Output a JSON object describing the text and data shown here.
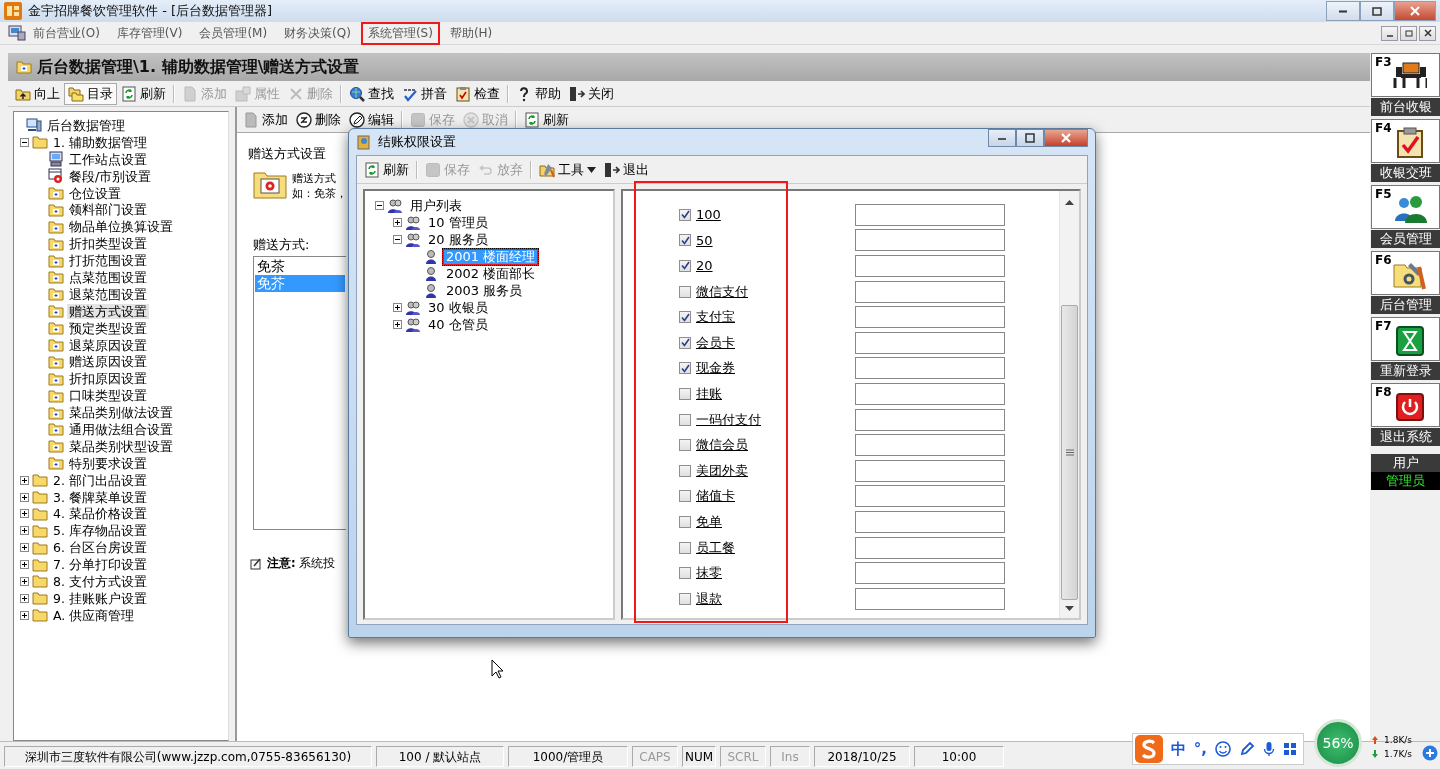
{
  "window": {
    "title": "金宇招牌餐饮管理软件 - [后台数据管理器]"
  },
  "menu": [
    {
      "label": "前台营业(O)",
      "annotated": false
    },
    {
      "label": "库存管理(V)",
      "annotated": false
    },
    {
      "label": "会员管理(M)",
      "annotated": false
    },
    {
      "label": "财务决策(Q)",
      "annotated": false
    },
    {
      "label": "系统管理(S)",
      "annotated": true
    },
    {
      "label": "帮助(H)",
      "annotated": false
    }
  ],
  "path": "后台数据管理\\1. 辅助数据管理\\赠送方式设置",
  "toolbar": [
    [
      {
        "kind": "up",
        "label": "向上",
        "disabled": false,
        "selected": false
      },
      {
        "kind": "catalog",
        "label": "目录",
        "disabled": false,
        "selected": true
      },
      {
        "kind": "refresh",
        "label": "刷新",
        "disabled": false,
        "selected": false
      }
    ],
    [
      {
        "kind": "add",
        "label": "添加",
        "disabled": true,
        "selected": false
      },
      {
        "kind": "props",
        "label": "属性",
        "disabled": true,
        "selected": false
      },
      {
        "kind": "delete",
        "label": "删除",
        "disabled": true,
        "selected": false
      }
    ],
    [
      {
        "kind": "find",
        "label": "查找",
        "disabled": false,
        "selected": false
      },
      {
        "kind": "spell",
        "label": "拼音",
        "disabled": false,
        "selected": false
      },
      {
        "kind": "check",
        "label": "检查",
        "disabled": false,
        "selected": false
      }
    ],
    [
      {
        "kind": "help",
        "label": "帮助",
        "disabled": false,
        "selected": false
      },
      {
        "kind": "exit",
        "label": "关闭",
        "disabled": false,
        "selected": false
      }
    ]
  ],
  "nav_tree": {
    "label": "后台数据管理",
    "kind": "root",
    "selected": false,
    "children": [
      {
        "label": "1. 辅助数据管理",
        "kind": "group",
        "selected": false,
        "expanded": true,
        "children": [
          {
            "label": "工作站点设置",
            "kind": "station",
            "selected": false
          },
          {
            "label": "餐段/市别设置",
            "kind": "schedule",
            "selected": false
          },
          {
            "label": "仓位设置",
            "kind": "entry",
            "selected": false
          },
          {
            "label": "领料部门设置",
            "kind": "entry",
            "selected": false
          },
          {
            "label": "物品单位换算设置",
            "kind": "entry",
            "selected": false
          },
          {
            "label": "折扣类型设置",
            "kind": "entry",
            "selected": false
          },
          {
            "label": "打折范围设置",
            "kind": "entry",
            "selected": false
          },
          {
            "label": "点菜范围设置",
            "kind": "entry",
            "selected": false
          },
          {
            "label": "退菜范围设置",
            "kind": "entry",
            "selected": false
          },
          {
            "label": "赠送方式设置",
            "kind": "entry",
            "selected": true
          },
          {
            "label": "预定类型设置",
            "kind": "entry",
            "selected": false
          },
          {
            "label": "退菜原因设置",
            "kind": "entry",
            "selected": false
          },
          {
            "label": "赠送原因设置",
            "kind": "entry",
            "selected": false
          },
          {
            "label": "折扣原因设置",
            "kind": "entry",
            "selected": false
          },
          {
            "label": "口味类型设置",
            "kind": "entry",
            "selected": false
          },
          {
            "label": "菜品类别做法设置",
            "kind": "entry",
            "selected": false
          },
          {
            "label": "通用做法组合设置",
            "kind": "entry",
            "selected": false
          },
          {
            "label": "菜品类别状型设置",
            "kind": "entry",
            "selected": false
          },
          {
            "label": "特别要求设置",
            "kind": "entry",
            "selected": false
          }
        ]
      },
      {
        "label": "2. 部门出品设置",
        "kind": "group",
        "selected": false,
        "expanded": false
      },
      {
        "label": "3. 餐牌菜单设置",
        "kind": "group",
        "selected": false,
        "expanded": false
      },
      {
        "label": "4. 菜品价格设置",
        "kind": "group",
        "selected": false,
        "expanded": false
      },
      {
        "label": "5. 库存物品设置",
        "kind": "group",
        "selected": false,
        "expanded": false
      },
      {
        "label": "6. 台区台房设置",
        "kind": "group",
        "selected": false,
        "expanded": false
      },
      {
        "label": "7. 分单打印设置",
        "kind": "group",
        "selected": false,
        "expanded": false
      },
      {
        "label": "8. 支付方式设置",
        "kind": "group",
        "selected": false,
        "expanded": false
      },
      {
        "label": "9. 挂账账户设置",
        "kind": "group",
        "selected": false,
        "expanded": false
      },
      {
        "label": "A. 供应商管理",
        "kind": "group",
        "selected": false,
        "expanded": false
      }
    ]
  },
  "detail": {
    "toolbar": [
      [
        {
          "kind": "add",
          "label": "添加",
          "disabled": false
        },
        {
          "kind": "remove",
          "label": "删除",
          "disabled": false
        },
        {
          "kind": "edit",
          "label": "编辑",
          "disabled": false
        }
      ],
      [
        {
          "kind": "save",
          "label": "保存",
          "disabled": true
        },
        {
          "kind": "cancel",
          "label": "取消",
          "disabled": true
        }
      ],
      [
        {
          "kind": "refresh",
          "label": "刷新",
          "disabled": false
        }
      ]
    ],
    "heading": "赠送方式设置",
    "description": [
      "赠送方式",
      "如：免茶，"
    ],
    "list_label": "赠送方式:",
    "list": [
      {
        "label": "免茶",
        "selected": false
      },
      {
        "label": "免芥",
        "selected": true
      }
    ],
    "note": "**注意:** 系统投"
  },
  "dialog": {
    "title": "结账权限设置",
    "toolbar": [
      [
        {
          "kind": "refresh",
          "label": "刷新",
          "disabled": false
        }
      ],
      [
        {
          "kind": "save",
          "label": "保存",
          "disabled": true
        },
        {
          "kind": "undo",
          "label": "放弃",
          "disabled": true
        }
      ],
      [
        {
          "kind": "tools",
          "label": "工具",
          "disabled": false
        },
        {
          "kind": "exit",
          "label": "退出",
          "disabled": false
        }
      ]
    ],
    "user_tree": {
      "label": "用户列表",
      "kind": "list",
      "selected": false,
      "annotated": false,
      "expanded": true,
      "children": [
        {
          "label": "10 管理员",
          "kind": "group",
          "selected": false,
          "annotated": false,
          "expanded": false
        },
        {
          "label": "20 服务员",
          "kind": "group",
          "selected": false,
          "annotated": false,
          "expanded": true,
          "children": [
            {
              "label": "2001 楼面经理",
              "kind": "user",
              "selected": true,
              "annotated": true
            },
            {
              "label": "2002 楼面部长",
              "kind": "user",
              "selected": false,
              "annotated": false
            },
            {
              "label": "2003 服务员",
              "kind": "user",
              "selected": false,
              "annotated": false
            }
          ]
        },
        {
          "label": "30 收银员",
          "kind": "group",
          "selected": false,
          "annotated": false,
          "expanded": false
        },
        {
          "label": "40 仓管员",
          "kind": "group",
          "selected": false,
          "annotated": false,
          "expanded": false
        }
      ]
    },
    "payments_annotated": true,
    "payments": [
      {
        "label": "100",
        "checked": true
      },
      {
        "label": "50",
        "checked": true
      },
      {
        "label": "20",
        "checked": true
      },
      {
        "label": "微信支付",
        "checked": false
      },
      {
        "label": "支付宝",
        "checked": true
      },
      {
        "label": "会员卡",
        "checked": true
      },
      {
        "label": "现金券",
        "checked": true
      },
      {
        "label": "挂账",
        "checked": false
      },
      {
        "label": "一码付支付",
        "checked": false
      },
      {
        "label": "微信会员",
        "checked": false
      },
      {
        "label": "美团外卖",
        "checked": false
      },
      {
        "label": "储值卡",
        "checked": false
      },
      {
        "label": "免单",
        "checked": false
      },
      {
        "label": "员工餐",
        "checked": false
      },
      {
        "label": "抹零",
        "checked": false
      },
      {
        "label": "退款",
        "checked": false
      }
    ]
  },
  "sidebar": [
    {
      "key": "F3",
      "label": "前台收银",
      "kind": "cashier"
    },
    {
      "key": "F4",
      "label": "收银交班",
      "kind": "handover"
    },
    {
      "key": "F5",
      "label": "会员管理",
      "kind": "members"
    },
    {
      "key": "F6",
      "label": "后台管理",
      "kind": "backend"
    },
    {
      "key": "F7",
      "label": "重新登录",
      "kind": "relogin"
    },
    {
      "key": "F8",
      "label": "退出系统",
      "kind": "exit"
    }
  ],
  "user": {
    "label": "用户",
    "name": "管理员"
  },
  "status_bar": [
    {
      "text": "深圳市三度软件有限公司(www.jzzp.com,0755-83656130)",
      "enabled": true
    },
    {
      "text": "100 / 默认站点",
      "enabled": true
    },
    {
      "text": "1000/管理员",
      "enabled": true
    },
    {
      "text": "CAPS",
      "enabled": false
    },
    {
      "text": "NUM",
      "enabled": true
    },
    {
      "text": "SCRL",
      "enabled": false
    },
    {
      "text": "Ins",
      "enabled": false
    },
    {
      "text": "2018/10/25",
      "enabled": true
    },
    {
      "text": "10:00",
      "enabled": true
    }
  ],
  "tray": {
    "ime_mode": "中",
    "ime_punct": "°,",
    "usage": "56%",
    "upload": "1.8K/s",
    "download": "1.7K/s"
  }
}
